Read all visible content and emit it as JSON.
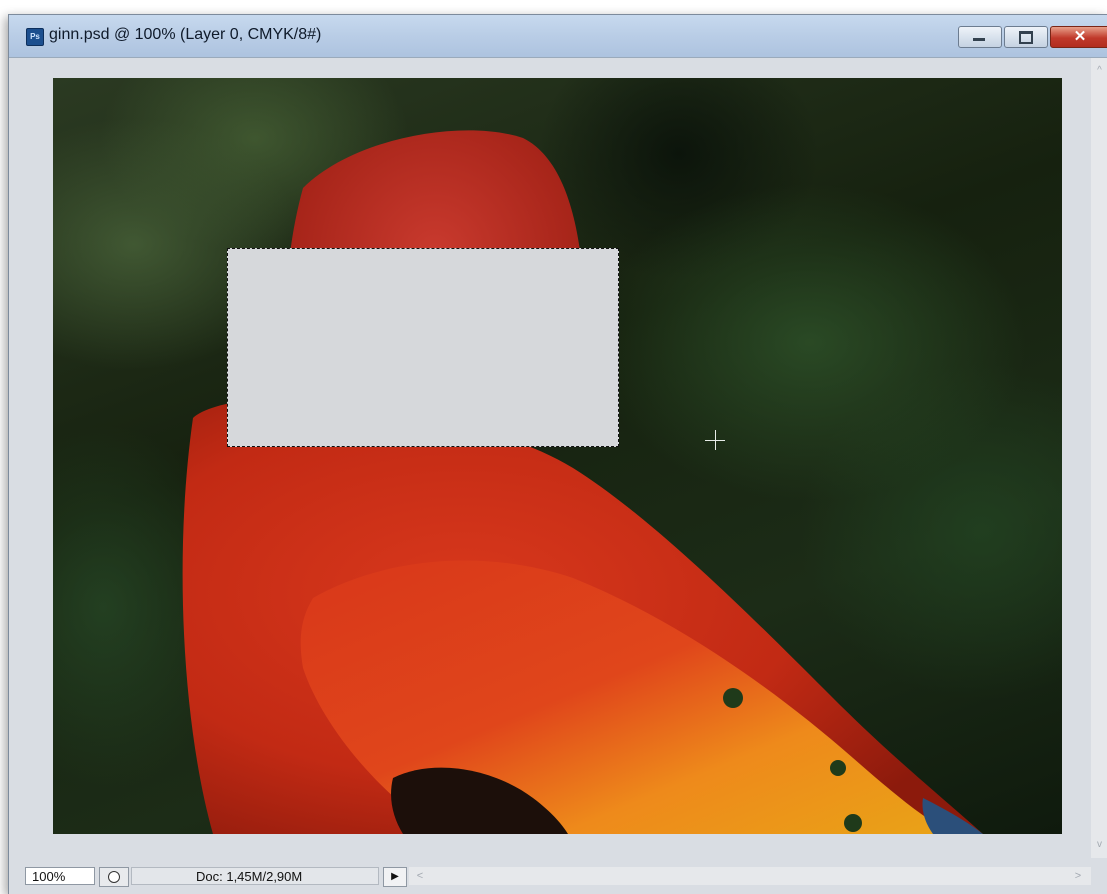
{
  "window": {
    "title": "ginn.psd @ 100% (Layer 0, CMYK/8#)",
    "app_icon_text": "Ps",
    "controls": {
      "minimize": "minimize",
      "maximize": "maximize",
      "close_label": "✕"
    }
  },
  "canvas": {
    "image_subject": "red-parrot-photo",
    "selection": "rectangular-marquee"
  },
  "status_bar": {
    "zoom": "100%",
    "doc_info": "Doc: 1,45M/2,90M",
    "menu_arrow": "▶",
    "scroll_left": "<",
    "scroll_right": ">"
  },
  "scrollbar": {
    "up": "^",
    "down": "v"
  },
  "colors": {
    "title_bar": "#b9cde6",
    "close_button": "#c0392b",
    "selection_fill": "#d6d8db",
    "window_bg": "#d9dde3"
  }
}
